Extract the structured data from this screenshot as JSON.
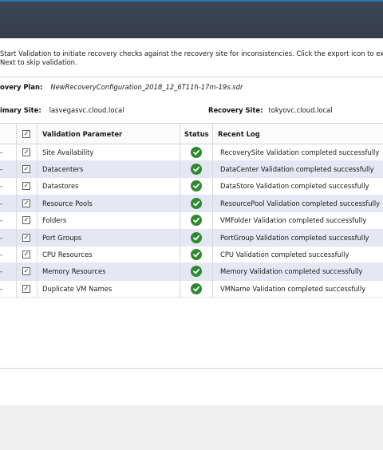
{
  "description": {
    "line1": "Start Validation to initiate recovery checks against the recovery site for inconsistencies. Click the export icon to export the valida",
    "line2": "Next to skip validation."
  },
  "plan": {
    "label": "overy Plan:",
    "value": "NewRecoveryConfiguration_2018_12_6T11h-17m-19s.sdr"
  },
  "sites": {
    "primary_label": "imary Site:",
    "primary_value": "lasvegasvc.cloud.local",
    "recovery_label": "Recovery Site:",
    "recovery_value": "tokyovc.cloud.local"
  },
  "table": {
    "headers": {
      "lead": "",
      "check": "✓",
      "parameter": "Validation Parameter",
      "status": "Status",
      "log": "Recent Log"
    },
    "rows": [
      {
        "lead": "-",
        "checked": "✓",
        "parameter": "Site Availability",
        "status": "success",
        "log": "RecoverySite Validation completed successfully"
      },
      {
        "lead": "-",
        "checked": "✓",
        "parameter": "Datacenters",
        "status": "success",
        "log": "DataCenter Validation completed successfully"
      },
      {
        "lead": "-",
        "checked": "✓",
        "parameter": "Datastores",
        "status": "success",
        "log": "DataStore Validation completed successfully"
      },
      {
        "lead": "-",
        "checked": "✓",
        "parameter": "Resource Pools",
        "status": "success",
        "log": "ResourcePool Validation completed successfully"
      },
      {
        "lead": "-",
        "checked": "✓",
        "parameter": "Folders",
        "status": "success",
        "log": "VMFolder Validation completed successfully"
      },
      {
        "lead": "-",
        "checked": "✓",
        "parameter": "Port Groups",
        "status": "success",
        "log": "PortGroup Validation completed successfully"
      },
      {
        "lead": "-",
        "checked": "✓",
        "parameter": "CPU Resources",
        "status": "success",
        "log": "CPU Validation completed successfully"
      },
      {
        "lead": "-",
        "checked": "✓",
        "parameter": "Memory Resources",
        "status": "success",
        "log": "Memory Validation completed successfully"
      },
      {
        "lead": "-",
        "checked": "✓",
        "parameter": "Duplicate VM Names",
        "status": "success",
        "log": "VMName Validation completed successfully"
      }
    ]
  },
  "colors": {
    "title_bar": "#353f4b",
    "row_alt": "#e5e7f4",
    "success": "#2e8a2e"
  },
  "icons": {
    "success": "check-circle-icon",
    "checkbox": "checkbox-checked-icon"
  }
}
